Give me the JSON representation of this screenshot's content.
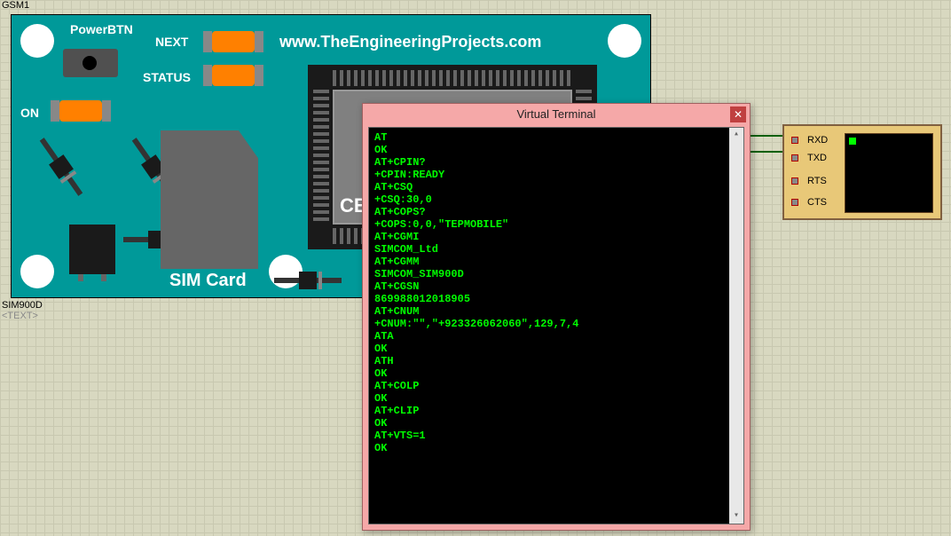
{
  "component": {
    "ref": "GSM1",
    "part": "SIM900D",
    "text_placeholder": "<TEXT>"
  },
  "board": {
    "power_btn": "PowerBTN",
    "next": "NEXT",
    "status": "STATUS",
    "on": "ON",
    "sim": "SIM Card",
    "ce_mark": "CE",
    "url": "www.TheEngineeringProjects.com"
  },
  "virtual_terminal": {
    "title": "Virtual Terminal",
    "close_tooltip": "Close",
    "lines": [
      "AT",
      "OK",
      "AT+CPIN?",
      "+CPIN:READY",
      "AT+CSQ",
      "+CSQ:30,0",
      "AT+COPS?",
      "+COPS:0,0,\"TEPMOBILE\"",
      "AT+CGMI",
      "SIMCOM_Ltd",
      "AT+CGMM",
      "SIMCOM_SIM900D",
      "AT+CGSN",
      "869988012018905",
      "AT+CNUM",
      "+CNUM:\"\",\"+923326062060\",129,7,4",
      "ATA",
      "OK",
      "ATH",
      "OK",
      "AT+COLP",
      "OK",
      "AT+CLIP",
      "OK",
      "AT+VTS=1",
      "OK"
    ]
  },
  "terminal_component": {
    "pins": [
      "RXD",
      "TXD",
      "RTS",
      "CTS"
    ]
  }
}
